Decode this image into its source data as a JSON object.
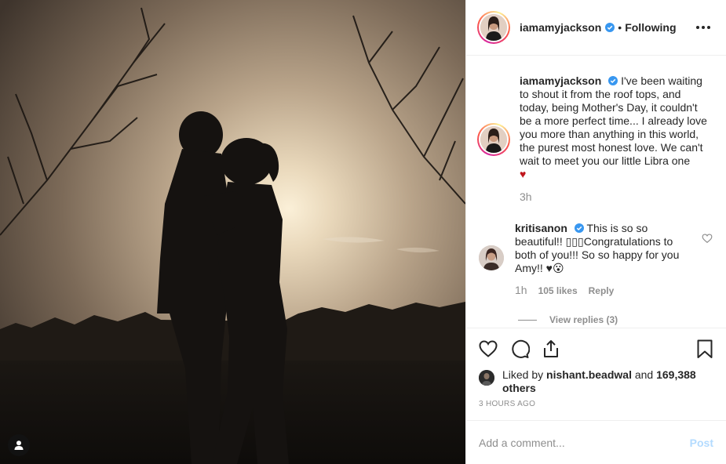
{
  "post": {
    "author": "iamamyjackson",
    "separator": "•",
    "follow_state": "Following",
    "verified_icon": "verified-badge-icon",
    "more_icon": "more-options-icon"
  },
  "caption": {
    "username": "iamamyjackson",
    "text": "I've been waiting to shout it from the roof tops, and today, being Mother's Day, it couldn't be a more perfect time... I already love you more than anything in this world, the purest most honest love. We can't wait to meet you our little Libra one",
    "emoji": "♥",
    "time": "3h"
  },
  "comments": [
    {
      "username": "kritisanon",
      "text": "This is so so beautiful!! ▯▯▯Congratulations to both of you!!! So so happy for you Amy!! ♥😮",
      "time": "1h",
      "likes": "105 likes",
      "reply": "Reply"
    }
  ],
  "view_replies": "View replies (3)",
  "actions": {
    "like_icon": "heart-icon",
    "comment_icon": "comment-icon",
    "share_icon": "share-icon",
    "save_icon": "bookmark-icon"
  },
  "likes": {
    "prefix": "Liked by",
    "user": "nishant.beadwal",
    "and": "and",
    "count": "169,388 others"
  },
  "timestamp": "3 HOURS AGO",
  "composer": {
    "placeholder": "Add a comment...",
    "post_label": "Post"
  },
  "colors": {
    "accent": "#0095f6",
    "verified": "#3897f0",
    "muted": "#8e8e8e",
    "post_disabled": "#b3dbff"
  }
}
